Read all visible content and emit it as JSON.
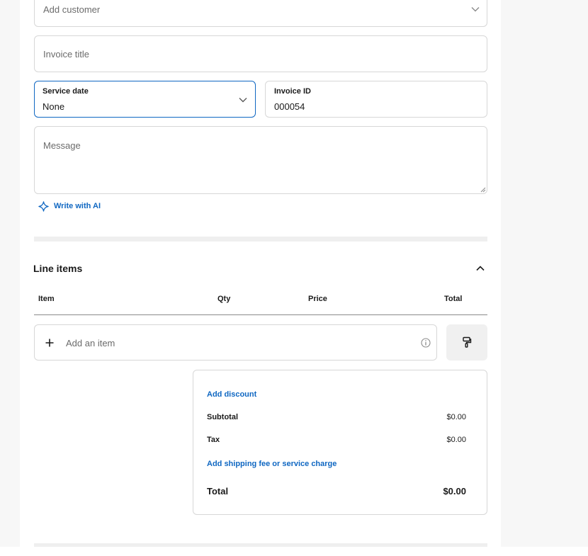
{
  "form": {
    "customer_placeholder": "Add customer",
    "title_placeholder": "Invoice title",
    "service_date_label": "Service date",
    "service_date_value": "None",
    "invoice_id_label": "Invoice ID",
    "invoice_id_value": "000054",
    "message_placeholder": "Message",
    "write_ai_label": "Write with AI"
  },
  "line_items": {
    "heading": "Line items",
    "columns": [
      "Item",
      "Qty",
      "Price",
      "Total"
    ],
    "add_item_placeholder": "Add an item"
  },
  "summary": {
    "add_discount": "Add discount",
    "subtotal_label": "Subtotal",
    "subtotal_value": "$0.00",
    "tax_label": "Tax",
    "tax_value": "$0.00",
    "add_shipping": "Add shipping fee or service charge",
    "total_label": "Total",
    "total_value": "$0.00"
  },
  "colors": {
    "accent": "#0f67c2",
    "border": "#d7d7d7",
    "background": "#f7f7f7"
  },
  "icons": [
    "chevron-down-icon",
    "sparkle-icon",
    "chevron-up-icon",
    "plus-icon",
    "info-icon",
    "paint-roller-icon"
  ]
}
